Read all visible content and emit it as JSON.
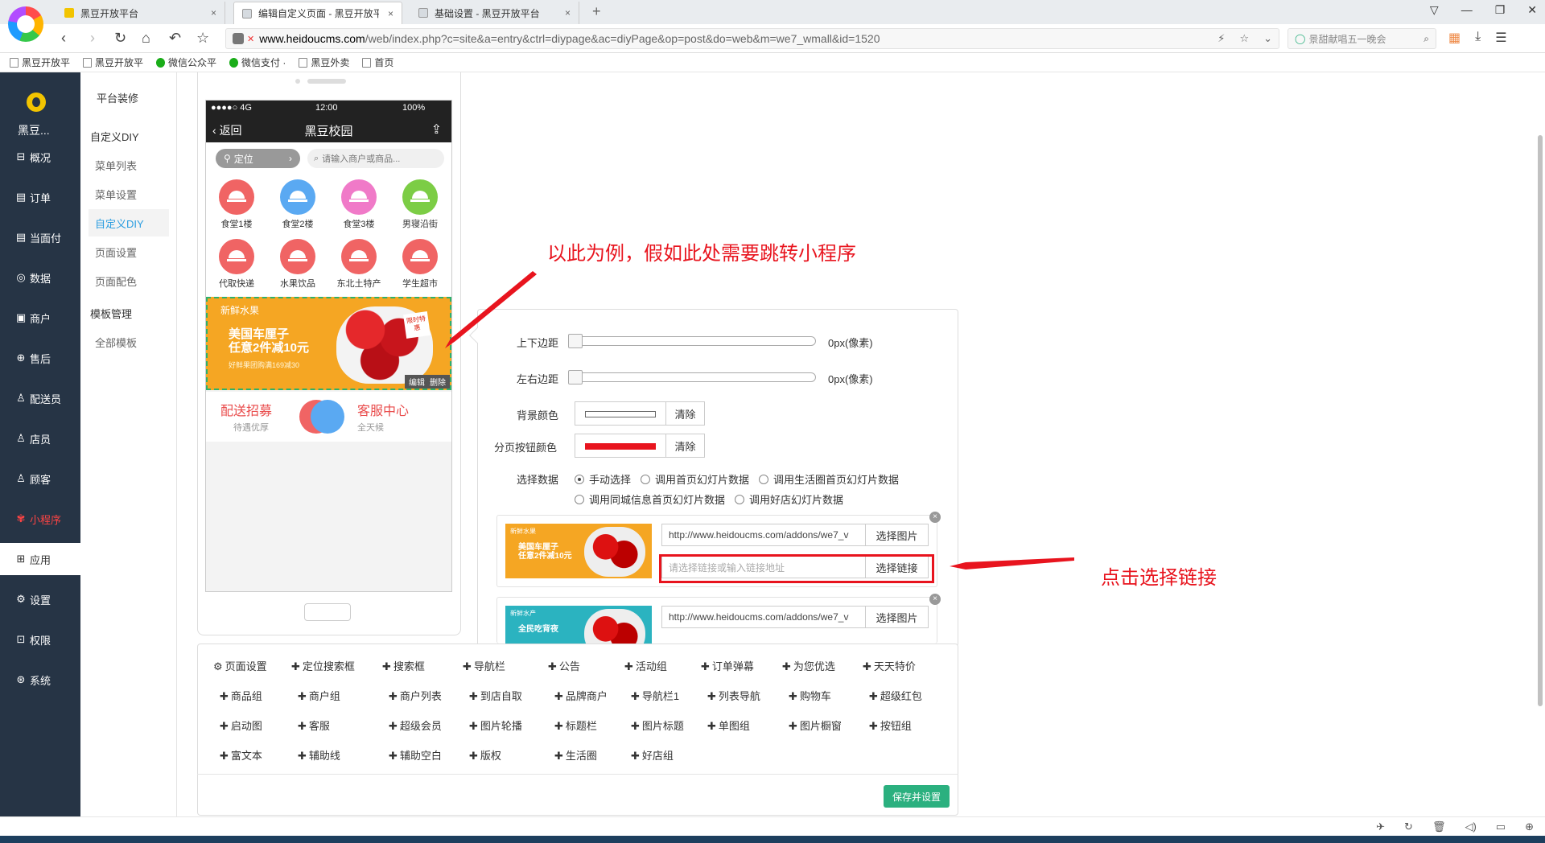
{
  "browser": {
    "tabs": [
      {
        "title": "黑豆开放平台",
        "favicon_color": "#f2c400",
        "active": false
      },
      {
        "title": "编辑自定义页面 - 黑豆开放平台",
        "favicon_color": "#d6dbe0",
        "active": true
      },
      {
        "title": "基础设置 - 黑豆开放平台",
        "favicon_color": "#d6dbe0",
        "active": false
      }
    ],
    "close_glyph": "×",
    "new_tab_glyph": "+",
    "url_domain": "www.heidoucms.com",
    "url_path": "/web/index.php?c=site&a=entry&ctrl=diypage&ac=diyPage&op=post&do=web&m=we7_wmall&id=1520",
    "search_text": "景甜献唱五一晚会",
    "bookmarks": [
      {
        "label": "黑豆开放平",
        "icon": "page-icon"
      },
      {
        "label": "黑豆开放平",
        "icon": "page-icon"
      },
      {
        "label": "微信公众平",
        "icon": "wechat-icon"
      },
      {
        "label": "微信支付 ·",
        "icon": "wechat-pay-icon"
      },
      {
        "label": "黑豆外卖",
        "icon": "page-icon"
      },
      {
        "label": "首页",
        "icon": "page-icon"
      }
    ]
  },
  "sidebar": {
    "brand": "黑豆...",
    "items": [
      {
        "label": "概况",
        "icon": "dashboard-icon"
      },
      {
        "label": "订单",
        "icon": "order-icon"
      },
      {
        "label": "当面付",
        "icon": "pay-icon"
      },
      {
        "label": "数据",
        "icon": "chart-icon"
      },
      {
        "label": "商户",
        "icon": "store-icon"
      },
      {
        "label": "售后",
        "icon": "service-icon"
      },
      {
        "label": "配送员",
        "icon": "user-icon"
      },
      {
        "label": "店员",
        "icon": "user-icon"
      },
      {
        "label": "顾客",
        "icon": "user-icon"
      },
      {
        "label": "小程序",
        "icon": "miniapp-icon"
      },
      {
        "label": "应用",
        "icon": "apps-icon"
      },
      {
        "label": "设置",
        "icon": "gear-icon"
      },
      {
        "label": "权限",
        "icon": "lock-icon"
      },
      {
        "label": "系统",
        "icon": "system-icon"
      }
    ]
  },
  "submenu": {
    "top": "平台装修",
    "group1": "自定义DIY",
    "items1": [
      "菜单列表",
      "菜单设置",
      "自定义DIY",
      "页面设置",
      "页面配色"
    ],
    "group2": "模板管理",
    "items2": [
      "全部模板"
    ]
  },
  "phone": {
    "carrier": "●●●●○ 4G",
    "time": "12:00",
    "battery": "100%",
    "back": "返回",
    "title": "黑豆校园",
    "location": "定位",
    "search_placeholder": "请输入商户或商品...",
    "nav_items": [
      {
        "label": "食堂1楼",
        "color": "#f06464"
      },
      {
        "label": "食堂2楼",
        "color": "#5aa9f2"
      },
      {
        "label": "食堂3楼",
        "color": "#f07ac8"
      },
      {
        "label": "男寝沿街",
        "color": "#7ccd45"
      },
      {
        "label": "代取快递",
        "color": "#f06464"
      },
      {
        "label": "水果饮品",
        "color": "#f06464"
      },
      {
        "label": "东北土特产",
        "color": "#f06464"
      },
      {
        "label": "学生超市",
        "color": "#f06464"
      }
    ],
    "banner": {
      "tag": "新鲜水果",
      "headline1": "美国车厘子",
      "headline2": "任意2件减10元",
      "sub": "好鲜果团购满169减30",
      "flash": "限时特惠",
      "edit": "编辑",
      "delete": "删除"
    },
    "services": [
      {
        "title": "配送招募",
        "subtitle": "待遇优厚",
        "color": "#f06464"
      },
      {
        "title": "客服中心",
        "subtitle": "全天候",
        "color": "#5aa9f2"
      }
    ]
  },
  "settings": {
    "vertical_margin_label": "上下边距",
    "horizontal_margin_label": "左右边距",
    "vertical_margin_value": "0px(像素)",
    "horizontal_margin_value": "0px(像素)",
    "bg_color_label": "背景颜色",
    "bg_color": "#ffffff",
    "pager_color_label": "分页按钮颜色",
    "pager_color": "#e8141e",
    "clear": "清除",
    "data_source_label": "选择数据",
    "options": [
      "手动选择",
      "调用首页幻灯片数据",
      "调用生活圈首页幻灯片数据",
      "调用同城信息首页幻灯片数据",
      "调用好店幻灯片数据"
    ],
    "selected": "手动选择",
    "slides": [
      {
        "image_url": "http://www.heidoucms.com/addons/we7_v",
        "link_placeholder": "请选择链接或输入链接地址",
        "thumb_tag": "新鲜水果",
        "thumb_title1": "美国车厘子",
        "thumb_title2": "任意2件减10元"
      },
      {
        "image_url": "http://www.heidoucms.com/addons/we7_v",
        "thumb_tag": "新鲜水产",
        "thumb_title1": "全民吃背夜"
      }
    ],
    "choose_image": "选择图片",
    "choose_link": "选择链接"
  },
  "components": {
    "row1": [
      "页面设置",
      "定位搜索框",
      "搜索框",
      "导航栏",
      "公告",
      "活动组",
      "订单弹幕",
      "为您优选",
      "天天特价"
    ],
    "row2": [
      "商品组",
      "商户组",
      "商户列表",
      "到店自取",
      "品牌商户",
      "导航栏1",
      "列表导航",
      "购物车",
      "超级红包"
    ],
    "row3": [
      "启动图",
      "客服",
      "超级会员",
      "图片轮播",
      "标题栏",
      "图片标题",
      "单图组",
      "图片橱窗",
      "按钮组"
    ],
    "row4": [
      "富文本",
      "辅助线",
      "辅助空白",
      "版权",
      "生活圈",
      "好店组"
    ],
    "save": "保存并设置"
  },
  "annotations": {
    "example": "以此为例，假如此处需要跳转小程序",
    "click_link": "点击选择链接",
    "color": "#e8141e"
  }
}
